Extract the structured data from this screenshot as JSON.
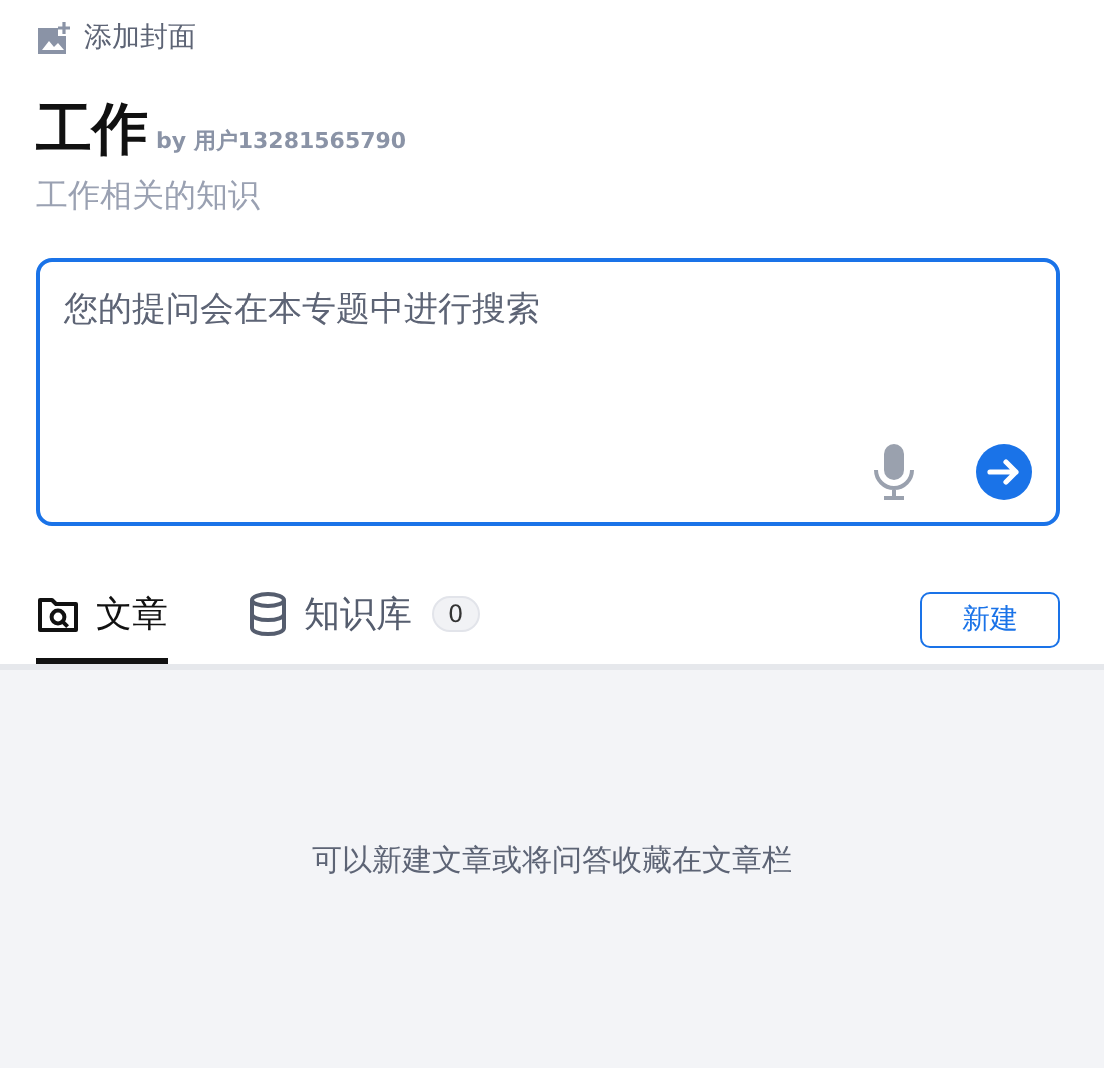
{
  "cover_button": {
    "label": "添加封面"
  },
  "topic": {
    "title": "工作",
    "author": "by 用户13281565790",
    "description": "工作相关的知识"
  },
  "question": {
    "placeholder": "您的提问会在本专题中进行搜索"
  },
  "tabs": [
    {
      "kind": "articles",
      "label": "文章",
      "selected": true
    },
    {
      "kind": "knowledge",
      "label": "知识库",
      "count": "0",
      "selected": false
    }
  ],
  "new_button": {
    "label": "新建"
  },
  "empty_message": "可以新建文章或将问答收藏在文章栏"
}
